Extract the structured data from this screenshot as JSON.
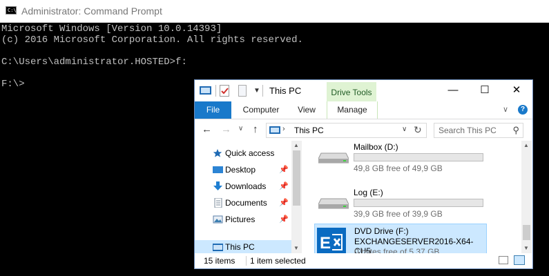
{
  "cmd": {
    "title": "Administrator: Command Prompt",
    "icon_text": "C:\\.",
    "lines": [
      "Microsoft Windows [Version 10.0.14393]",
      "(c) 2016 Microsoft Corporation. All rights reserved.",
      "",
      "C:\\Users\\administrator.HOSTED>f:",
      "",
      "F:\\>"
    ]
  },
  "explorer": {
    "title": "This PC",
    "context_tab": "Drive Tools",
    "window_buttons": {
      "minimize": "—",
      "maximize": "☐",
      "close": "✕"
    },
    "tabs": [
      "File",
      "Computer",
      "View",
      "Manage"
    ],
    "help": "?",
    "address": "This PC",
    "search_placeholder": "Search This PC",
    "nav": [
      {
        "label": "Quick access",
        "icon": "star-icon",
        "pinned": false
      },
      {
        "label": "Desktop",
        "icon": "desktop-folder-icon",
        "pinned": true
      },
      {
        "label": "Downloads",
        "icon": "download-arrow-icon",
        "pinned": true
      },
      {
        "label": "Documents",
        "icon": "documents-icon",
        "pinned": true
      },
      {
        "label": "Pictures",
        "icon": "pictures-icon",
        "pinned": true
      },
      {
        "label": "This PC",
        "icon": "computer-icon",
        "pinned": false,
        "selected": true
      }
    ],
    "drives": [
      {
        "name": "Mailbox (D:)",
        "free": "49,8 GB free of 49,9 GB",
        "used_fraction": 0.0,
        "icon": "hard-drive-icon"
      },
      {
        "name": "Log (E:)",
        "free": "39,9 GB free of 39,9 GB",
        "used_fraction": 0.0,
        "icon": "hard-drive-icon"
      },
      {
        "name": "DVD Drive (F:)",
        "label": "EXCHANGESERVER2016-X64-CU5",
        "free": "0 bytes free of 5,37 GB",
        "icon": "exchange-logo-icon",
        "selected": true
      }
    ],
    "status": {
      "items": "15 items",
      "selected": "1 item selected"
    },
    "colors": {
      "accent": "#1979ca",
      "drive_tools": "#dff3d3",
      "selection": "#cce8ff"
    }
  }
}
